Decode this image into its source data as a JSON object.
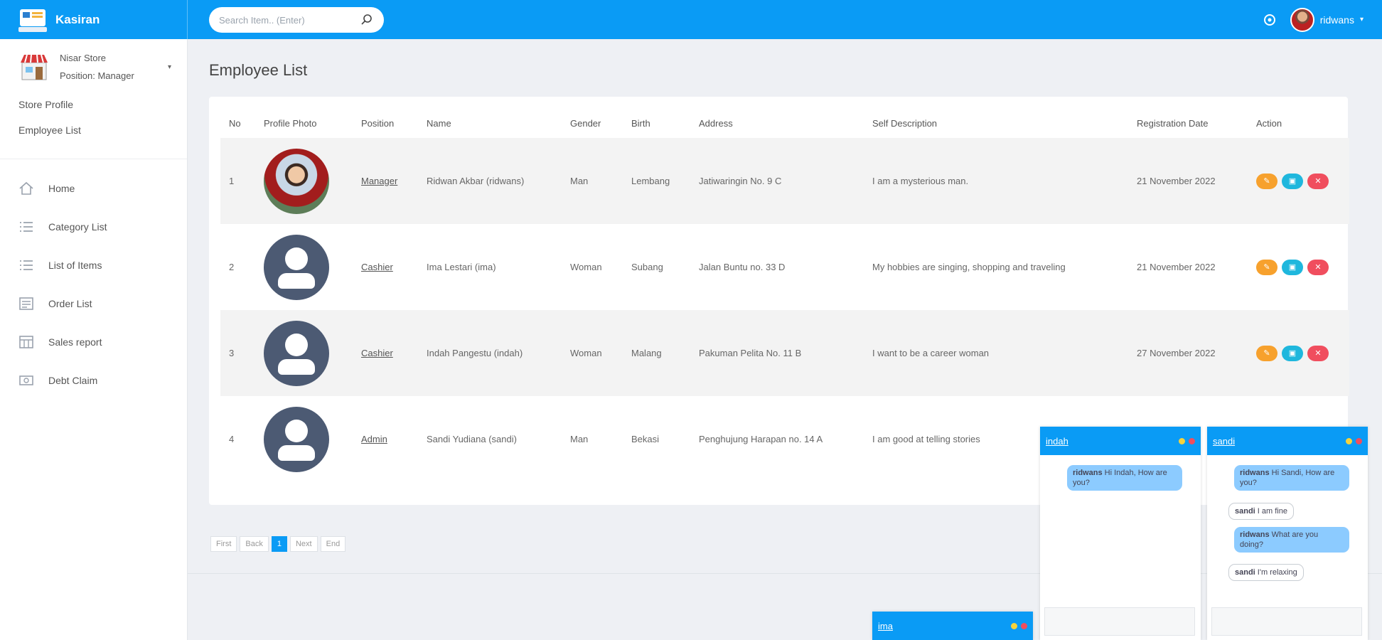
{
  "app": {
    "name": "Kasiran"
  },
  "search": {
    "placeholder": "Search Item.. (Enter)"
  },
  "user": {
    "name": "ridwans"
  },
  "store": {
    "name": "Nisar Store",
    "position": "Position: Manager"
  },
  "sidebar": {
    "links": [
      "Store Profile",
      "Employee List"
    ],
    "items": [
      {
        "label": "Home",
        "icon": "home-icon"
      },
      {
        "label": "Category List",
        "icon": "list-icon"
      },
      {
        "label": "List of Items",
        "icon": "list-icon"
      },
      {
        "label": "Order List",
        "icon": "order-icon"
      },
      {
        "label": "Sales report",
        "icon": "report-icon"
      },
      {
        "label": "Debt Claim",
        "icon": "debt-icon"
      }
    ]
  },
  "page": {
    "title": "Employee List"
  },
  "table": {
    "headers": [
      "No",
      "Profile Photo",
      "Position",
      "Name",
      "Gender",
      "Birth",
      "Address",
      "Self Description",
      "Registration Date",
      "Action"
    ],
    "rows": [
      {
        "no": "1",
        "position": "Manager",
        "name": "Ridwan Akbar (ridwans)",
        "gender": "Man",
        "birth": "Lembang",
        "address": "Jatiwaringin No. 9 C",
        "desc": "I am a mysterious man.",
        "date": "21 November 2022",
        "photo": "real"
      },
      {
        "no": "2",
        "position": "Cashier",
        "name": "Ima Lestari (ima)",
        "gender": "Woman",
        "birth": "Subang",
        "address": "Jalan Buntu no. 33 D",
        "desc": "My hobbies are singing, shopping and traveling",
        "date": "21 November 2022",
        "photo": "placeholder"
      },
      {
        "no": "3",
        "position": "Cashier",
        "name": "Indah Pangestu (indah)",
        "gender": "Woman",
        "birth": "Malang",
        "address": "Pakuman Pelita No. 11 B",
        "desc": "I want to be a career woman",
        "date": "27 November 2022",
        "photo": "placeholder"
      },
      {
        "no": "4",
        "position": "Admin",
        "name": "Sandi Yudiana (sandi)",
        "gender": "Man",
        "birth": "Bekasi",
        "address": "Penghujung Harapan no. 14 A",
        "desc": "I am good at telling stories",
        "date": "",
        "photo": "placeholder"
      }
    ]
  },
  "pagination": {
    "first": "First",
    "back": "Back",
    "current": "1",
    "next": "Next",
    "end": "End"
  },
  "chats": [
    {
      "name": "indah",
      "messages": [
        {
          "from": "ridwans",
          "text": "Hi Indah, How are you?",
          "mine": true
        }
      ]
    },
    {
      "name": "sandi",
      "messages": [
        {
          "from": "ridwans",
          "text": "Hi Sandi, How are you?",
          "mine": true
        },
        {
          "from": "sandi",
          "text": "I am fine",
          "mine": false
        },
        {
          "from": "ridwans",
          "text": "What are you doing?",
          "mine": true
        },
        {
          "from": "sandi",
          "text": "I'm relaxing",
          "mine": false
        }
      ]
    },
    {
      "name": "ima",
      "messages": []
    }
  ],
  "colors": {
    "primary": "#0a9bf5",
    "edit": "#f7a12d",
    "chat": "#1fb7dd",
    "delete": "#f04e5e"
  }
}
